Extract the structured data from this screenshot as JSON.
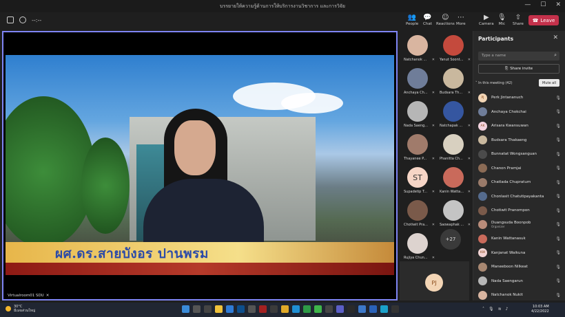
{
  "window": {
    "title": "บรรยายให้ความรู้ด้านการให้บริการงานวิชาการ และการวิจัย"
  },
  "toolbar": {
    "timer": "--:--",
    "people": "People",
    "chat": "Chat",
    "reactions": "Reactions",
    "more": "More",
    "camera": "Camera",
    "mic": "Mic",
    "share": "Share",
    "leave": "Leave"
  },
  "stage": {
    "caption": "ผศ.ดร.สายบังอร ปานพรม",
    "label": "Virtualroom01 SDU"
  },
  "gallery": [
    {
      "name": "Natchanok ...",
      "color": "#d9b5a0"
    },
    {
      "name": "Yanut Soont...",
      "color": "#c44a3d"
    },
    {
      "name": "Anchaya Ch...",
      "color": "#6f7d99"
    },
    {
      "name": "Budsara Th...",
      "color": "#c9b89e"
    },
    {
      "name": "Nada Saeng...",
      "color": "#b6b6b6"
    },
    {
      "name": "Natchapak ...",
      "color": "#3556a0"
    },
    {
      "name": "Thayanee P...",
      "color": "#a07b6b"
    },
    {
      "name": "Phanitta Ch...",
      "color": "#d8d0c0"
    },
    {
      "name": "Supadetip T...",
      "initials": "ST",
      "color": "#f6d5c6"
    },
    {
      "name": "Kanin Watta...",
      "color": "#c96a5b"
    },
    {
      "name": "Chotiwit Pra...",
      "color": "#7a5a4a"
    },
    {
      "name": "Saowaphak ...",
      "color": "#c4c4c4"
    },
    {
      "name": "Rujiya Chun...",
      "color": "#ddd3cf"
    }
  ],
  "more_count": "+27",
  "self": {
    "initials": "PJ"
  },
  "panel": {
    "title": "Participants",
    "search_placeholder": "Type a name",
    "share_invite": "Share invite",
    "in_meeting": "In this meeting (42)",
    "mute_all": "Mute all",
    "participants": [
      {
        "name": "Perk Jintananuch",
        "initials": "PJ",
        "color": "#f3d5b5"
      },
      {
        "name": "Anchaya Chokchai",
        "color": "#6f7d99"
      },
      {
        "name": "Arisara Kwansuwan",
        "initials": "AK",
        "color": "#f4d4df"
      },
      {
        "name": "Budsara Thakaeng",
        "color": "#c9b89e"
      },
      {
        "name": "Bunnatat Wongsanguan",
        "color": "#4b4b4b"
      },
      {
        "name": "Chanon Pramjai",
        "color": "#8b6b55"
      },
      {
        "name": "Chatlada Chupratum",
        "color": "#9a7b6a"
      },
      {
        "name": "Chonlasit Chatutipayakanta",
        "color": "#556b8d"
      },
      {
        "name": "Chotiwit Pranompon",
        "color": "#7a5a4a"
      },
      {
        "name": "Duangsuda Boonpob",
        "sub": "Organizer",
        "color": "#b98c7a"
      },
      {
        "name": "Kanin Wattanasuk",
        "color": "#c96a5b"
      },
      {
        "name": "Kanjanat Waikuna",
        "initials": "KW",
        "color": "#f2d3d3"
      },
      {
        "name": "Maneeboon Nilkeat",
        "color": "#a88872"
      },
      {
        "name": "Nada Saengarun",
        "color": "#b6b6b6"
      },
      {
        "name": "Natchanok Nukit",
        "color": "#d9b5a0"
      }
    ]
  },
  "taskbar": {
    "temp": "30°C",
    "weather": "มีเมฆส่วนใหญ่",
    "time": "10:03 AM",
    "date": "4/22/2022"
  }
}
